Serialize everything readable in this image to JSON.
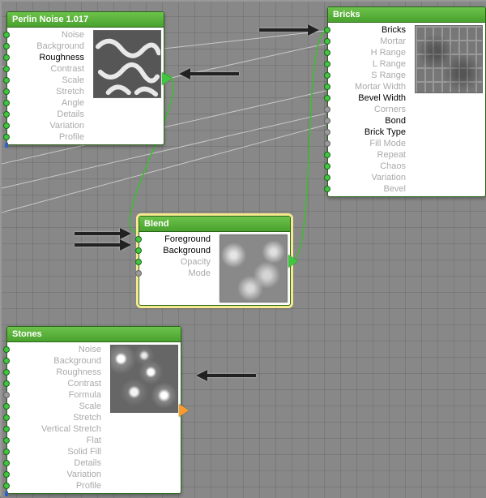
{
  "nodes": {
    "perlin": {
      "title": "Perlin Noise 1.017",
      "params": [
        "Noise",
        "Background",
        "Roughness",
        "Contrast",
        "Scale",
        "Stretch",
        "Angle",
        "Details",
        "Variation",
        "Profile"
      ],
      "connected_params": [
        "Roughness"
      ]
    },
    "bricks": {
      "title": "Bricks",
      "params": [
        "Bricks",
        "Mortar",
        "H Range",
        "L Range",
        "S Range",
        "Mortar Width",
        "Bevel Width",
        "Corners",
        "Bond",
        "Brick Type",
        "Fill Mode",
        "Repeat",
        "Chaos",
        "Variation",
        "Bevel"
      ],
      "connected_params": [
        "Bricks",
        "Bevel Width",
        "Bond",
        "Brick Type"
      ]
    },
    "blend": {
      "title": "Blend",
      "params": [
        "Foreground",
        "Background",
        "Opacity",
        "Mode"
      ],
      "connected_params": [
        "Foreground",
        "Background"
      ]
    },
    "stones": {
      "title": "Stones",
      "params": [
        "Noise",
        "Background",
        "Roughness",
        "Contrast",
        "Formula",
        "Scale",
        "Stretch",
        "Vertical Stretch",
        "Flat",
        "Solid Fill",
        "Details",
        "Variation",
        "Profile"
      ],
      "connected_params": []
    }
  }
}
